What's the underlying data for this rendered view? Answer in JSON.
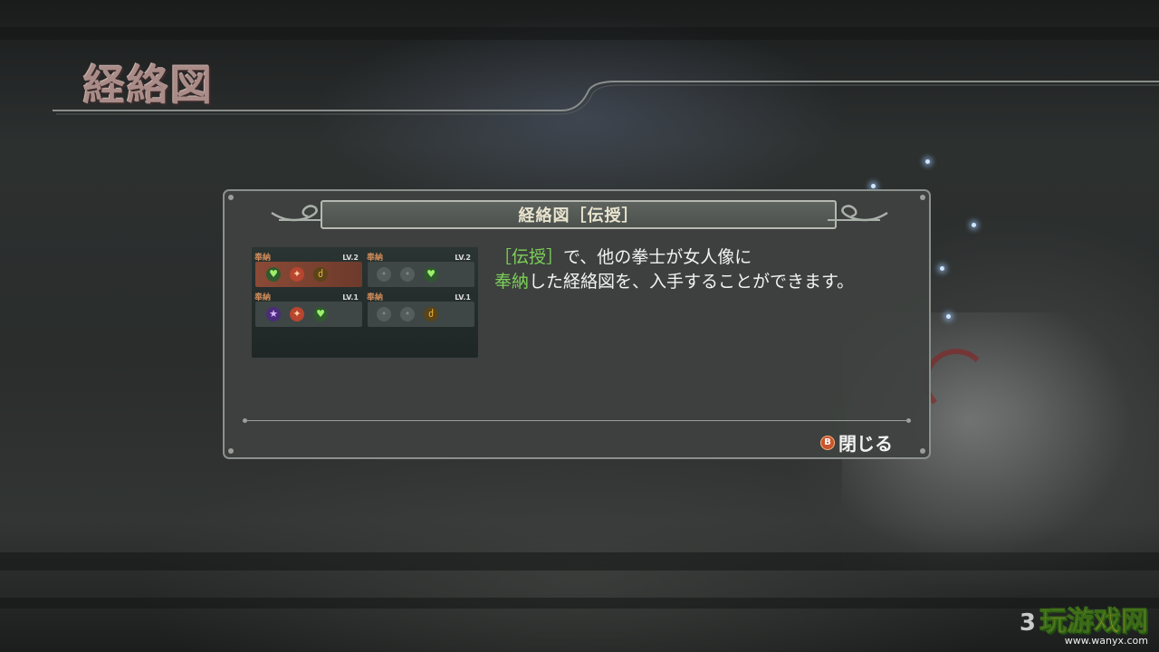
{
  "page": {
    "title": "経絡図"
  },
  "dialog": {
    "title": "経絡図［伝授］",
    "description": {
      "highlight_1": "［伝授］",
      "text_1": "で、他の拳士が女人像に",
      "highlight_2": "奉納",
      "text_2": "した経絡図を、入手することができます。"
    },
    "preview": {
      "slots": [
        {
          "tag": "奉納",
          "level": "LV.2",
          "active": true,
          "gems": [
            "heart",
            "red",
            "gold"
          ]
        },
        {
          "tag": "奉納",
          "level": "LV.2",
          "active": false,
          "gems": [
            "empty",
            "empty",
            "heart"
          ]
        },
        {
          "tag": "奉納",
          "level": "LV.1",
          "active": false,
          "gems": [
            "purple",
            "red",
            "heart"
          ]
        },
        {
          "tag": "奉納",
          "level": "LV.1",
          "active": false,
          "gems": [
            "empty",
            "empty",
            "gold"
          ]
        }
      ]
    },
    "close": {
      "button_icon": "B",
      "label": "閉じる"
    }
  },
  "watermark": {
    "number": "3",
    "brand": "玩游戏网",
    "url": "www.wanyx.com"
  },
  "colors": {
    "highlight": "#7dd05a",
    "title": "#a98c88",
    "panel": "#3e4240"
  },
  "icons": [
    "scroll-ornament-icon",
    "heart-gem-icon",
    "fire-gem-icon",
    "flame-gem-icon",
    "star-gem-icon",
    "b-button-icon"
  ]
}
